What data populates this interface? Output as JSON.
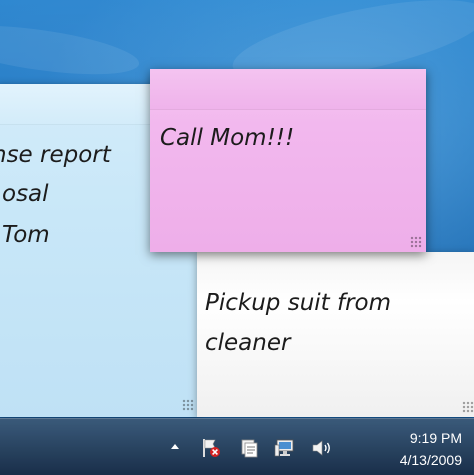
{
  "notes": {
    "blue": {
      "lines": [
        "nse report",
        "osal",
        "Tom"
      ]
    },
    "pink": {
      "text": "Call Mom!!!"
    },
    "white": {
      "lines": [
        "Pickup suit from",
        "cleaner"
      ]
    }
  },
  "taskbar": {
    "tray": {
      "icons": [
        "show-hidden-icons-arrow",
        "action-center-flag-icon",
        "sticky-notes-tray-icon",
        "network-icon",
        "volume-icon"
      ]
    },
    "clock": {
      "time": "9:19 PM",
      "date": "4/13/2009"
    }
  },
  "colors": {
    "desktop": "#1e6fb7",
    "note_blue": "#c8e7f8",
    "note_pink": "#f2b8ee",
    "note_white": "#f5f5f5",
    "taskbar": "#1f3a5a"
  }
}
